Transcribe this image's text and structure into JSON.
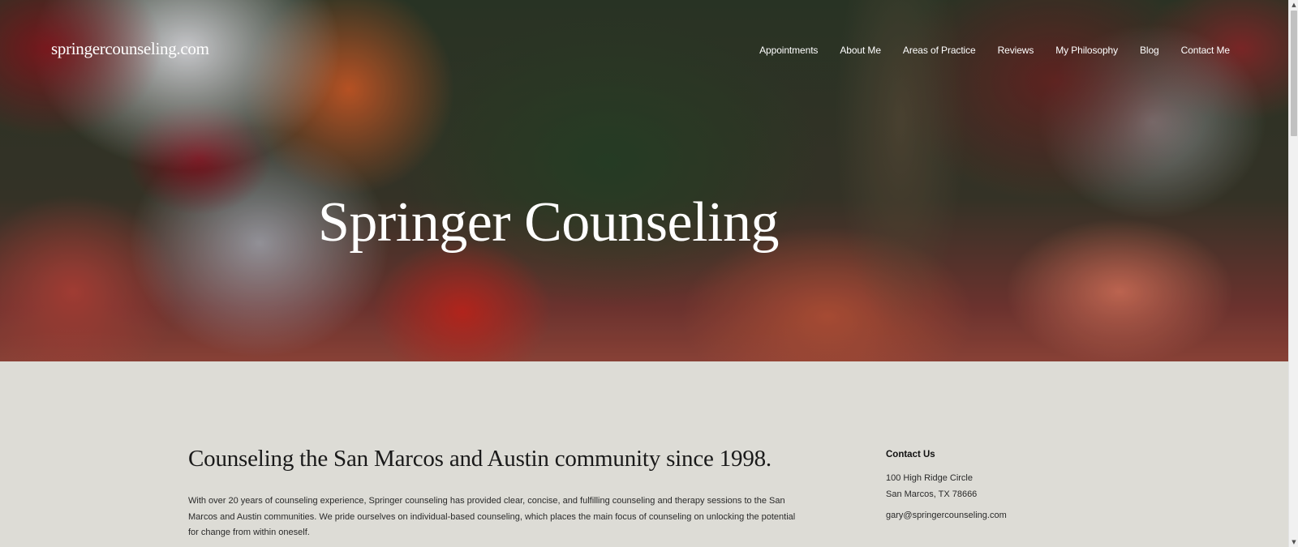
{
  "header": {
    "logo_text": "springercounseling.com",
    "nav": [
      {
        "label": "Appointments"
      },
      {
        "label": "About Me"
      },
      {
        "label": "Areas of Practice"
      },
      {
        "label": "Reviews"
      },
      {
        "label": "My Philosophy"
      },
      {
        "label": "Blog"
      },
      {
        "label": "Contact Me"
      }
    ]
  },
  "hero": {
    "title": "Springer Counseling"
  },
  "main": {
    "heading": "Counseling the San Marcos and Austin community since 1998.",
    "body": "With over 20 years of counseling experience, Springer counseling has provided clear, concise, and fulfilling counseling and therapy sessions to the San Marcos and Austin communities. We pride ourselves on individual-based counseling, which places the main focus of counseling on unlocking the potential for change from within oneself."
  },
  "contact": {
    "title": "Contact Us",
    "address_line1": "100 High Ridge Circle",
    "address_line2": "San Marcos, TX 78666",
    "email": "gary@springercounseling.com"
  },
  "scrollbar": {
    "up_arrow_icon": "triangle-up-icon",
    "down_arrow_icon": "triangle-down-icon"
  }
}
